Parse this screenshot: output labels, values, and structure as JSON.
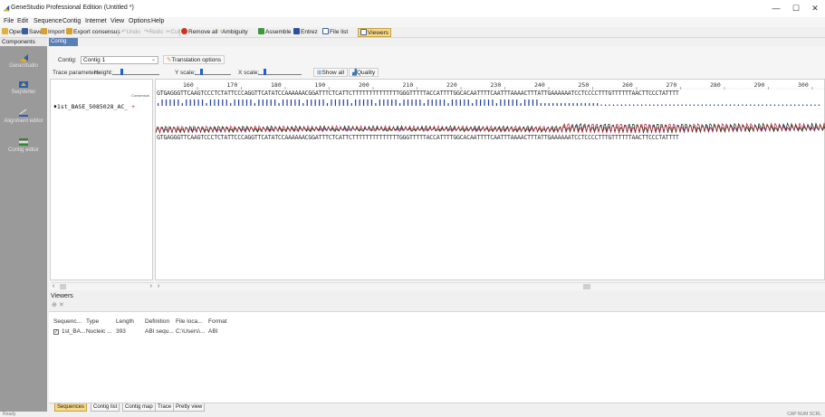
{
  "window": {
    "title": "GeneStudio Professional Edition (Untitled *)",
    "minimize": "—",
    "maximize": "☐",
    "close": "✕"
  },
  "menu": [
    "File",
    "Edit",
    "Sequence",
    "Contig",
    "Internet",
    "View",
    "Options",
    "Help"
  ],
  "toolbar": {
    "open": "Open",
    "save": "Save",
    "import": "Import",
    "export_consensus": "Export consensus",
    "undo": "Undo",
    "redo": "Redo",
    "cut": "Cut",
    "remove_all": "Remove all",
    "ambiguity": "Ambiguity",
    "assemble": "Assemble",
    "entrez": "Entrez",
    "file_list": "File list",
    "viewers": "Viewers"
  },
  "components": {
    "header": "Components",
    "items": [
      {
        "label": "GeneStudio",
        "icon": "genestudio-icon"
      },
      {
        "label": "SeqVerter",
        "icon": "seqverter-icon"
      },
      {
        "label": "Alignment editor",
        "icon": "alignment-editor-icon"
      },
      {
        "label": "Contig editor",
        "icon": "contig-editor-icon"
      }
    ]
  },
  "contig_editor": {
    "tab": "Contig editor",
    "contig_label": "Contig:",
    "contig_value": "Contig 1",
    "translation_options": "Translation options",
    "trace_params": "Trace parameters:",
    "height": "Height:",
    "y_scale": "Y scale:",
    "x_scale": "X scale:",
    "height_level": 0.18,
    "y_scale_level": 0.15,
    "x_scale_level": 0.12,
    "show_all": "Show all",
    "quality": "Quality"
  },
  "sequence_view": {
    "ruler_ticks": [
      "160",
      "170",
      "180",
      "190",
      "200",
      "210",
      "220",
      "230",
      "240",
      "250",
      "260",
      "270",
      "280",
      "290",
      "300"
    ],
    "consensus_label": "Consensus",
    "read_name": "1st_BASE_5085028_AC_",
    "consensus_seq": "GTGAGGGTTCAAGTCCCTCTATTCCCAGGTTCATATCCAAAAAACGGATTTCTCATTCTTTTTTTTTTTTTTGGGTTTTTACCATTTTGGCACAATTTTCAATTTAAAACTTTATTGAAAAAATCCTCCCCTTTGTTTTTTAACTTCCCTATTTT",
    "read_seq": "GTGAGGGTTCAAGTCCCTCTATTCCCAGGTTCATATCCAAAAAACGGATTTCTCATTCTTTTTTTTTTTTTTGGGTTTTTACCATTTTGGCACAATTTTCAATTTAAAACTTTATTGAAAAAATCCTCCCCTTTGTTTTTTAACTTCCCTATTTT"
  },
  "viewers": {
    "header": "Viewers",
    "tool_icons": [
      "add-viewer-icon",
      "remove-viewer-icon"
    ],
    "columns": [
      "Sequenc...",
      "Type",
      "Length",
      "Definition",
      "File loca...",
      "Format"
    ],
    "rows": [
      [
        "1st_BA...",
        "Nucleic ...",
        "393",
        "ABI sequ...",
        "C:\\Users\\...",
        "ABI"
      ]
    ]
  },
  "bottom_tabs": [
    "Sequences",
    "Contig list",
    "Contig map",
    "Trace",
    "Pretty view"
  ],
  "status": {
    "left": "Ready",
    "right": "CAP NUM SCRL"
  },
  "colors": {
    "accent": "#5a7fb5",
    "trace_a": "#1a9a1a",
    "trace_c": "#1a3fd8",
    "trace_g": "#111111",
    "trace_t": "#e02020",
    "quality_bar": "#1f3ca8"
  }
}
